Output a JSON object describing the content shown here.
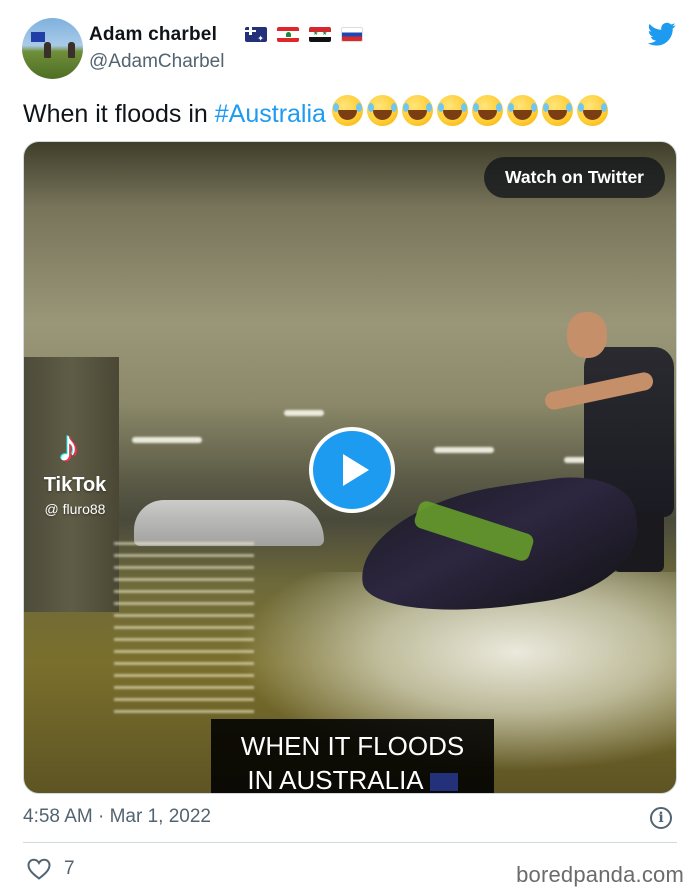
{
  "author": {
    "display_name": "Adam charbel",
    "handle": "@AdamCharbel",
    "flags": [
      "flag-australia-icon",
      "flag-lebanon-icon",
      "flag-syria-icon",
      "flag-russia-icon"
    ]
  },
  "tweet": {
    "text_prefix": "When it floods in ",
    "hashtag": "#Australia",
    "emoji_count": 8,
    "emoji_icon": "face-with-tears-of-joy-icon"
  },
  "media": {
    "watch_label": "Watch on Twitter",
    "tiktok_label": "TikTok",
    "tiktok_handle": "@ fluro88",
    "caption_line1": "WHEN IT FLOODS",
    "caption_line2": "IN AUSTRALIA"
  },
  "meta": {
    "timestamp": "4:58 AM · Mar 1, 2022",
    "like_count": "7"
  },
  "watermark": "boredpanda.com",
  "colors": {
    "twitter_blue": "#1d9bf0",
    "text": "#0f1419",
    "secondary_text": "#536471"
  }
}
